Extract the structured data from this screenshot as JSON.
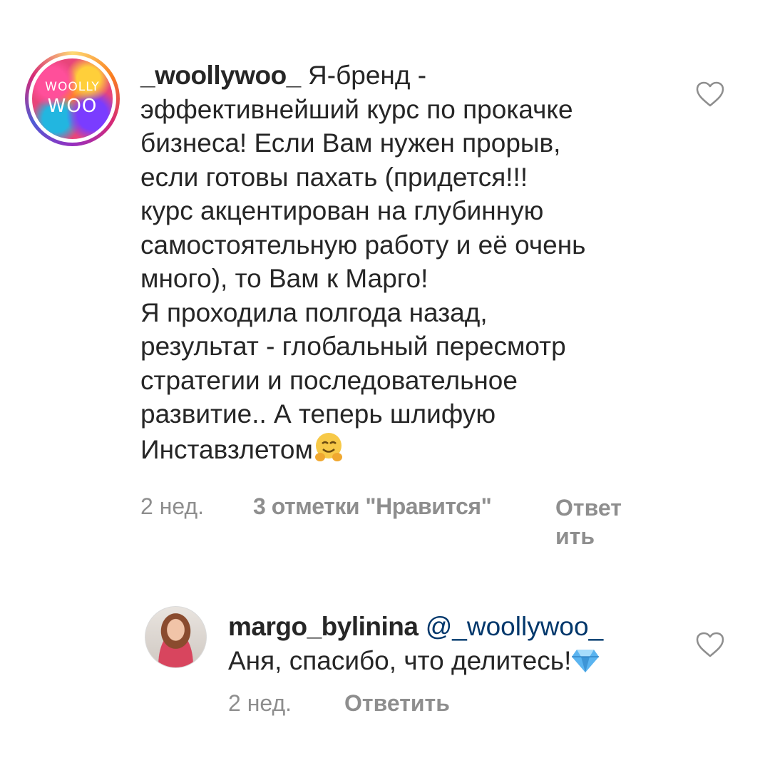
{
  "comments": [
    {
      "username": "_woollywoo_",
      "avatar_text_top": "WOOLLY",
      "avatar_text_bottom": "WOO",
      "text_first": " Я-бренд -",
      "text_lines": [
        "эффективнейший курс по прокачке",
        "бизнеса! Если Вам нужен прорыв,",
        "если готовы пахать (придется!!!",
        "курс акцентирован на глубинную",
        "самостоятельную работу и её очень",
        "много), то Вам к Марго!",
        "Я проходила полгода назад,",
        "результат - глобальный пересмотр",
        "стратегии и последовательное",
        "развитие.. А теперь шлифую"
      ],
      "text_last": "Инставзлетом",
      "emoji": "hugging-face-emoji",
      "time": "2 нед.",
      "likes": "3 отметки \"Нравится\"",
      "reply_line1": "Ответ",
      "reply_line2": "ить",
      "like_icon": "heart-outline-icon"
    },
    {
      "username": "margo_bylinina",
      "mention": "@_woollywoo_",
      "text": "Аня, спасибо, что делитесь!",
      "emoji": "gem-emoji",
      "time": "2 нед.",
      "reply": "Ответить",
      "like_icon": "heart-outline-icon"
    }
  ],
  "colors": {
    "text": "#262626",
    "meta": "#8e8e8e",
    "mention": "#00376b",
    "emoji_yellow": "#f7c948",
    "gem_blue": "#5ab4f0"
  }
}
